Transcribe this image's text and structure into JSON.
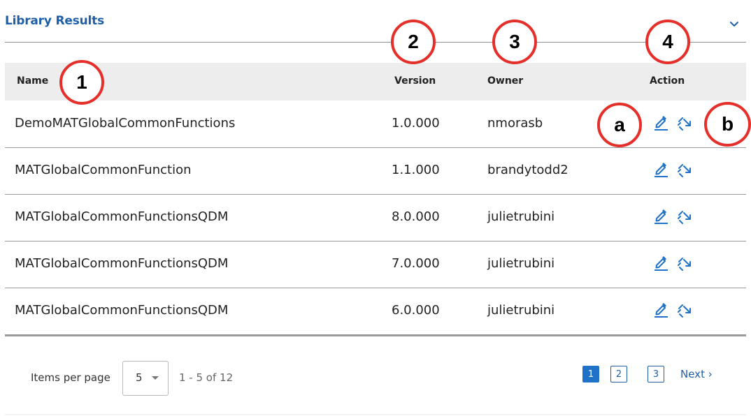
{
  "section": {
    "title": "Library Results",
    "collapse_icon": "chevron-down-icon"
  },
  "columns": {
    "name": "Name",
    "version": "Version",
    "owner": "Owner",
    "action": "Action"
  },
  "rows": [
    {
      "name": "DemoMATGlobalCommonFunctions",
      "version": "1.0.000",
      "owner": "nmorasb"
    },
    {
      "name": "MATGlobalCommonFunction",
      "version": "1.1.000",
      "owner": "brandytodd2"
    },
    {
      "name": "MATGlobalCommonFunctionsQDM",
      "version": "8.0.000",
      "owner": "julietrubini"
    },
    {
      "name": "MATGlobalCommonFunctionsQDM",
      "version": "7.0.000",
      "owner": "julietrubini"
    },
    {
      "name": "MATGlobalCommonFunctionsQDM",
      "version": "6.0.000",
      "owner": "julietrubini"
    }
  ],
  "row_actions": [
    "edit-icon",
    "unlink-icon"
  ],
  "pagination": {
    "items_per_page_label": "Items per page",
    "items_per_page_value": "5",
    "range_text": "1 - 5 of 12",
    "pages": [
      "1",
      "2",
      "3"
    ],
    "current_page": "1",
    "next_label": "Next ›"
  },
  "annotations": {
    "col_name": "1",
    "col_version": "2",
    "col_owner": "3",
    "col_action": "4",
    "edit": "a",
    "unlink": "b",
    "color": "#e52f2a"
  },
  "colors": {
    "accent": "#1f5fa8",
    "header_bg": "#ededed"
  }
}
